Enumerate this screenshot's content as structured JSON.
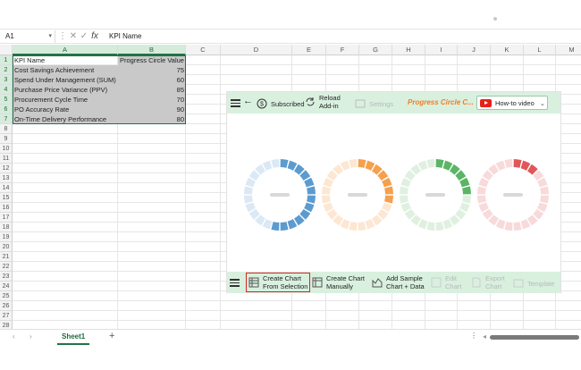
{
  "formula_bar": {
    "name_box": "A1",
    "value": "KPI Name"
  },
  "columns": [
    "A",
    "B",
    "C",
    "D",
    "E",
    "F",
    "G",
    "H",
    "I",
    "J",
    "K",
    "L",
    "M"
  ],
  "rows": [
    "1",
    "2",
    "3",
    "4",
    "5",
    "6",
    "7",
    "8",
    "9",
    "10",
    "11",
    "12",
    "13",
    "14",
    "15",
    "16",
    "17",
    "18",
    "19",
    "20",
    "21",
    "22",
    "23",
    "24",
    "25",
    "26",
    "27",
    "28"
  ],
  "table": {
    "header": [
      "KPI Name",
      "Progress Circle Value"
    ],
    "rows": [
      [
        "Cost Savings Achievement",
        "75"
      ],
      [
        "Spend Under Management (SUM)",
        "60"
      ],
      [
        "Purchase Price Variance (PPV)",
        "85"
      ],
      [
        "Procurement Cycle Time",
        "70"
      ],
      [
        "PO Accuracy Rate",
        "90"
      ],
      [
        "On-Time Delivery Performance",
        "80"
      ]
    ]
  },
  "addin": {
    "toolbar": {
      "subscribed": "Subscribed",
      "reload": "Reload",
      "addin": "Add-in",
      "settings": "Settings",
      "title": "Progress Circle C...",
      "how_to": "How-to video"
    },
    "charts": [
      {
        "value": 0.55,
        "color": "#5b9bd0",
        "light": "#dbe8f5"
      },
      {
        "value": 0.3,
        "color": "#f5a04e",
        "light": "#fde7d2"
      },
      {
        "value": 0.24,
        "color": "#5bb565",
        "light": "#dff0e0"
      },
      {
        "value": 0.12,
        "color": "#e0575a",
        "light": "#f8dadb"
      }
    ],
    "bottom": {
      "create_sel_1": "Create Chart",
      "create_sel_2": "From Selection",
      "create_man_1": "Create Chart",
      "create_man_2": "Manually",
      "add_sample_1": "Add Sample",
      "add_sample_2": "Chart + Data",
      "edit_1": "Edit",
      "edit_2": "Chart",
      "export_1": "Export",
      "export_2": "Chart",
      "template": "Template"
    }
  },
  "sheet": {
    "tab": "Sheet1"
  },
  "colors": {
    "excel_green": "#217346",
    "addin_bar": "#d9f0df",
    "title_orange": "#f07d27"
  }
}
